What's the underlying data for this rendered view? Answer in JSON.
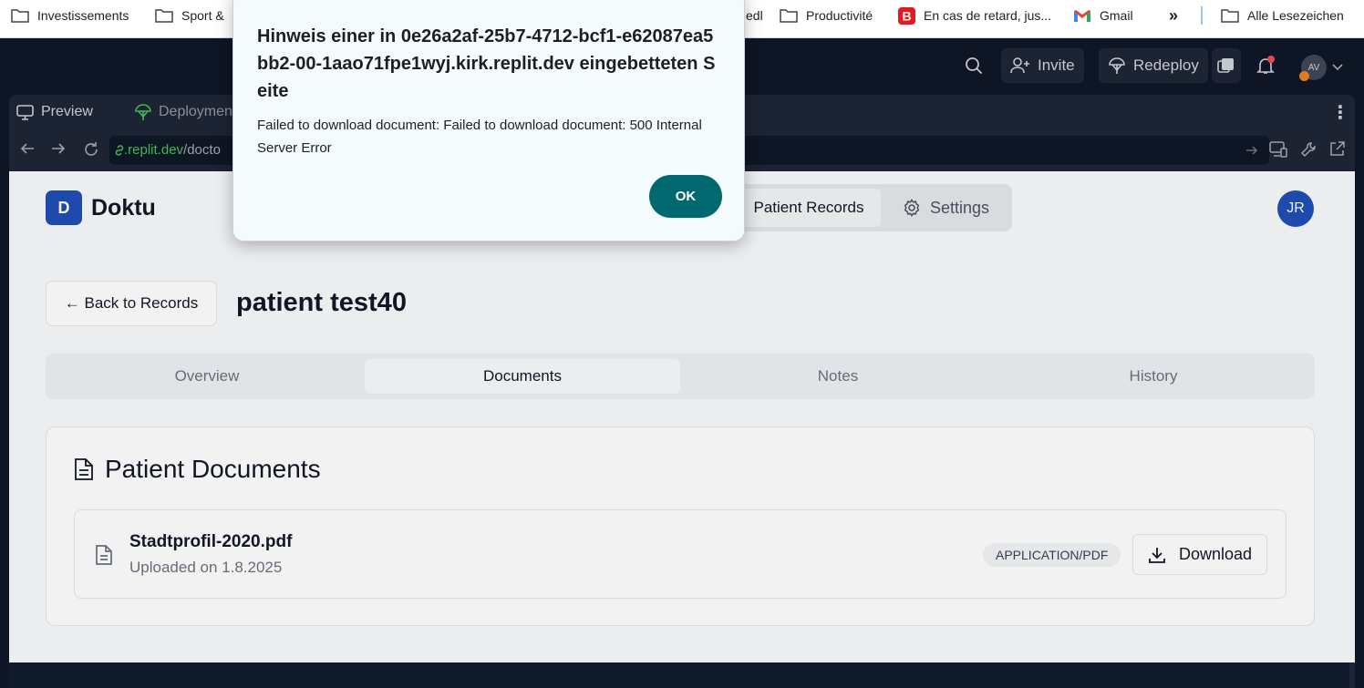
{
  "bookmarks": {
    "items": [
      "Investissements",
      "Sport &",
      "edl",
      "Productivité",
      "En cas de retard, jus...",
      "Gmail"
    ],
    "all_bookmarks": "Alle Lesezeichen"
  },
  "replit": {
    "invite": "Invite",
    "redeploy": "Redeploy",
    "avatar": "AV",
    "tabs": {
      "preview": "Preview",
      "deployments": "Deploymen"
    },
    "url": {
      "domain": ".replit.dev",
      "path": "/docto"
    }
  },
  "app": {
    "logo_letter": "D",
    "name": "Doktu",
    "nav": {
      "records": "Patient Records",
      "settings": "Settings"
    },
    "user_initials": "JR",
    "back": "← Back to Records",
    "patient_name": "patient test40",
    "tabs": [
      "Overview",
      "Documents",
      "Notes",
      "History"
    ],
    "active_tab": "Documents",
    "documents_heading": "Patient Documents",
    "document": {
      "name": "Stadtprofil-2020.pdf",
      "uploaded": "Uploaded on 1.8.2025",
      "type": "APPLICATION/PDF",
      "download": "Download"
    }
  },
  "dialog": {
    "title": "Hinweis einer in 0e26a2af-25b7-4712-bcf1-e62087ea5bb2-00-1aao71fpe1wyj.kirk.replit.dev eingebetteten Seite",
    "message": "Failed to download document: Failed to download document: 500 Internal Server Error",
    "ok": "OK"
  },
  "colors": {
    "brand": "#1f4fb5",
    "dialog_ok": "#00696f",
    "replit_bg": "#0e1525"
  }
}
